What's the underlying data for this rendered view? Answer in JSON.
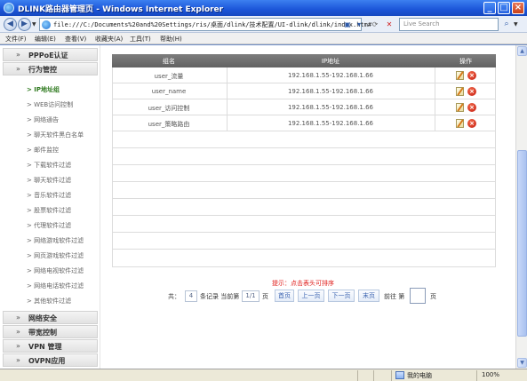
{
  "window": {
    "title": "DLINK路由器管理页 - Windows Internet Explorer",
    "minimize_symbol": "_",
    "maximize_symbol": "□",
    "close_symbol": "×"
  },
  "address_bar": {
    "url": "file:///C:/Documents%20and%20Settings/ris/桌面/dlink/技术配置/UI-dlink/dlink/index.htm#",
    "search_placeholder": "Live Search"
  },
  "menu": [
    "文件(F)",
    "编辑(E)",
    "查看(V)",
    "收藏夹(A)",
    "工具(T)",
    "帮助(H)"
  ],
  "sidebar": {
    "groups_top": [
      {
        "label": "PPPoE认证"
      },
      {
        "label": "行为管控"
      }
    ],
    "items": [
      {
        "label": "> IP地址组",
        "active": true
      },
      {
        "label": "> WEB访问控制",
        "active": false
      },
      {
        "label": "> 网络通告",
        "active": false
      },
      {
        "label": "> 聊天软件黑白名单",
        "active": false
      },
      {
        "label": "> 邮件监控",
        "active": false
      },
      {
        "label": "> 下载软件过滤",
        "active": false
      },
      {
        "label": "> 聊天软件过滤",
        "active": false
      },
      {
        "label": "> 音乐软件过滤",
        "active": false
      },
      {
        "label": "> 股票软件过滤",
        "active": false
      },
      {
        "label": "> 代理软件过滤",
        "active": false
      },
      {
        "label": "> 网络游戏软件过滤",
        "active": false
      },
      {
        "label": "> 网页游戏软件过滤",
        "active": false
      },
      {
        "label": "> 网络电视软件过滤",
        "active": false
      },
      {
        "label": "> 网络电话软件过滤",
        "active": false
      },
      {
        "label": "> 其他软件过滤",
        "active": false
      }
    ],
    "groups_bottom": [
      {
        "label": "网络安全"
      },
      {
        "label": "带宽控制"
      },
      {
        "label": "VPN 管理"
      },
      {
        "label": "OVPN应用"
      }
    ],
    "arrow": "»"
  },
  "table": {
    "headers": {
      "name": "组名",
      "ip": "IP地址",
      "action": "操作"
    },
    "rows": [
      {
        "name": "user_流量",
        "ip": "192.168.1.55-192.168.1.66"
      },
      {
        "name": "user_name",
        "ip": "192.168.1.55-192.168.1.66"
      },
      {
        "name": "user_访问控制",
        "ip": "192.168.1.55-192.168.1.66"
      },
      {
        "name": "user_策略路由",
        "ip": "192.168.1.55-192.168.1.66"
      }
    ],
    "hint": "提示：点击表头可排序"
  },
  "pager": {
    "total_label": "共：",
    "total": "4",
    "records_label": "条记录 当前第",
    "current": "1/1",
    "page_label": "页",
    "first": "首页",
    "prev": "上一页",
    "next": "下一页",
    "last": "末页",
    "goto_label": "前往 第",
    "goto_suffix": "页"
  },
  "statusbar": {
    "zone": "我的电脑",
    "zoom": "100%"
  },
  "colors": {
    "titlebar": "#1b55d8",
    "table_header": "#6e6e6e",
    "active_item": "#2f7a1f",
    "hint": "#e0201e"
  }
}
